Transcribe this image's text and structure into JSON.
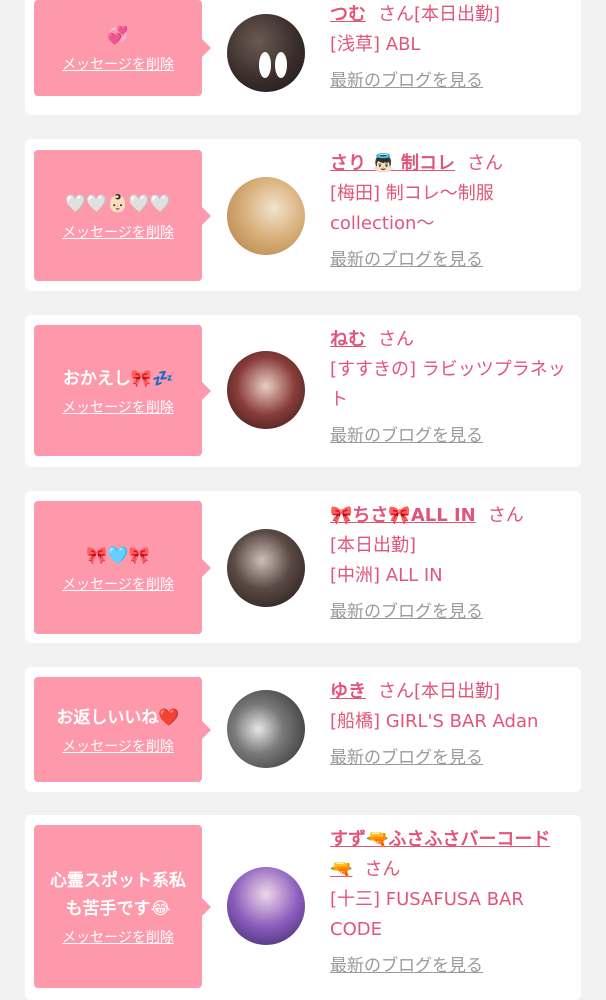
{
  "delete_label": "メッセージを削除",
  "blog_label": "最新のブログを見る",
  "san": "さん",
  "cards": [
    {
      "message": "💞",
      "name": "つむ",
      "suffix": "[本日出勤]",
      "store": "[浅草] ABL"
    },
    {
      "message": "🤍🤍👶🏻🤍🤍",
      "name": "さり 👼🏻 制コレ",
      "suffix": "",
      "store": "[梅田] 制コレ〜制服collection〜"
    },
    {
      "message": "おかえし🎀💤",
      "name": "ねむ",
      "suffix": "",
      "store": "[すすきの] ラビッツプラネット"
    },
    {
      "message": "🎀🩵🎀",
      "name": "🎀ちさ🎀ALL IN",
      "suffix": "",
      "store_line1": "[本日出勤]",
      "store": "[中洲] ALL IN"
    },
    {
      "message": "お返しいいね❤️",
      "name": "ゆき",
      "suffix": "[本日出勤]",
      "store": "[船橋] GIRL'S BAR Adan"
    },
    {
      "message": "心霊スポット系私も苦手です😂",
      "name": "すず🔫ふさふさバーコード🔫",
      "suffix": "",
      "store": "[十三] FUSAFUSA BAR CODE"
    }
  ],
  "colors": {
    "accent": "#e2557a",
    "bubble": "#fd99ab",
    "link_gray": "#9a9a9a",
    "page_bg": "#f2f2f2"
  }
}
